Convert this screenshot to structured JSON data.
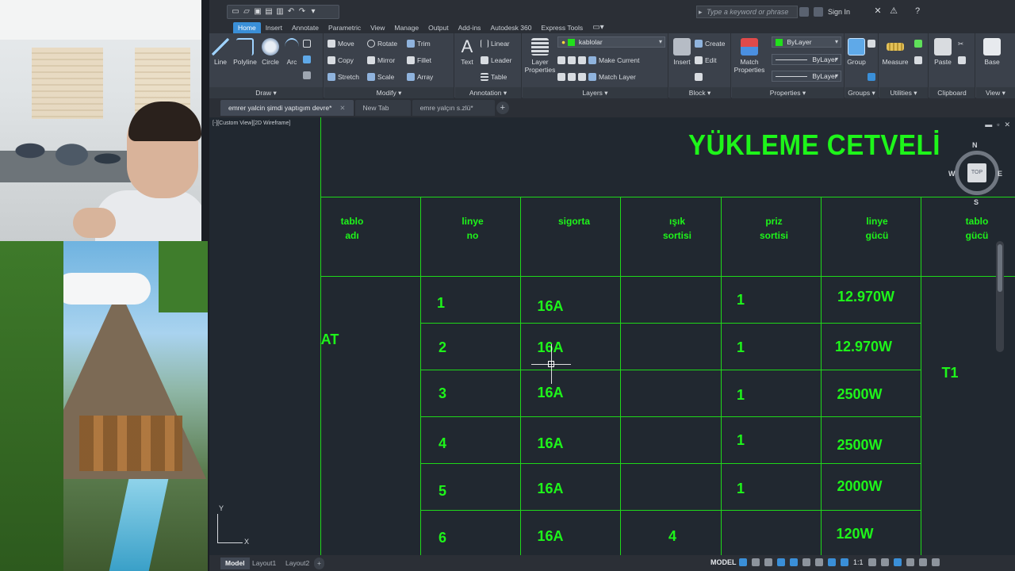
{
  "quick_access": {
    "search_placeholder": "Type a keyword or phrase",
    "sign_in": "Sign In"
  },
  "ribbon_tabs": [
    "Home",
    "Insert",
    "Annotate",
    "Parametric",
    "View",
    "Manage",
    "Output",
    "Add-ins",
    "Autodesk 360",
    "Express Tools"
  ],
  "ribbon": {
    "draw": {
      "title": "Draw",
      "line": "Line",
      "polyline": "Polyline",
      "circle": "Circle",
      "arc": "Arc"
    },
    "modify": {
      "title": "Modify",
      "move": "Move",
      "rotate": "Rotate",
      "trim": "Trim",
      "copy": "Copy",
      "mirror": "Mirror",
      "fillet": "Fillet",
      "stretch": "Stretch",
      "scale": "Scale",
      "array": "Array"
    },
    "annotation": {
      "title": "Annotation",
      "text": "Text",
      "linear": "Linear",
      "leader": "Leader",
      "table": "Table"
    },
    "layers": {
      "title": "Layers",
      "layer_properties_1": "Layer",
      "layer_properties_2": "Properties",
      "current_layer": "kablolar",
      "make_current": "Make Current",
      "match_layer": "Match Layer"
    },
    "block": {
      "title": "Block",
      "insert": "Insert",
      "create": "Create",
      "edit": "Edit"
    },
    "properties": {
      "title": "Properties",
      "match_1": "Match",
      "match_2": "Properties",
      "color": "ByLayer",
      "linetype": "ByLayer",
      "lineweight": "ByLayer"
    },
    "groups": {
      "title": "Groups",
      "group": "Group"
    },
    "utilities": {
      "title": "Utilities",
      "measure": "Measure"
    },
    "clipboard": {
      "title": "Clipboard",
      "paste": "Paste"
    },
    "view": {
      "title": "View",
      "base": "Base"
    }
  },
  "file_tabs": [
    {
      "label": "emrer yalcin şimdi yaptıgım devre*"
    },
    {
      "label": "New Tab"
    },
    {
      "label": "emre yalçın s.zlü*"
    }
  ],
  "viewport": {
    "label": "[-][Custom View][2D Wireframe]",
    "viewcube": {
      "top": "TOP",
      "n": "N",
      "s": "S",
      "e": "E",
      "w": "W"
    }
  },
  "drawing": {
    "title": "YÜKLEME CETVELİ",
    "headers": [
      {
        "line1": "tablo",
        "line2": "adı"
      },
      {
        "line1": "linye",
        "line2": "no"
      },
      {
        "line1": "sigorta",
        "line2": ""
      },
      {
        "line1": "ışık",
        "line2": "sortisi"
      },
      {
        "line1": "priz",
        "line2": "sortisi"
      },
      {
        "line1": "linye",
        "line2": "gücü"
      },
      {
        "line1": "tablo",
        "line2": "gücü"
      }
    ],
    "panel_name": "AT",
    "panel_power": "T1",
    "rows": [
      {
        "no": "1",
        "fuse": "16A",
        "light": "",
        "socket": "1",
        "power": "12.970W"
      },
      {
        "no": "2",
        "fuse": "16A",
        "light": "",
        "socket": "1",
        "power": "12.970W"
      },
      {
        "no": "3",
        "fuse": "16A",
        "light": "",
        "socket": "1",
        "power": "2500W"
      },
      {
        "no": "4",
        "fuse": "16A",
        "light": "",
        "socket": "1",
        "power": "2500W"
      },
      {
        "no": "5",
        "fuse": "16A",
        "light": "",
        "socket": "1",
        "power": "2000W"
      },
      {
        "no": "6",
        "fuse": "16A",
        "light": "4",
        "socket": "",
        "power": "120W"
      }
    ]
  },
  "statusbar": {
    "layouts": [
      "Model",
      "Layout1",
      "Layout2"
    ],
    "model_space": "MODEL",
    "scale": "1:1"
  }
}
